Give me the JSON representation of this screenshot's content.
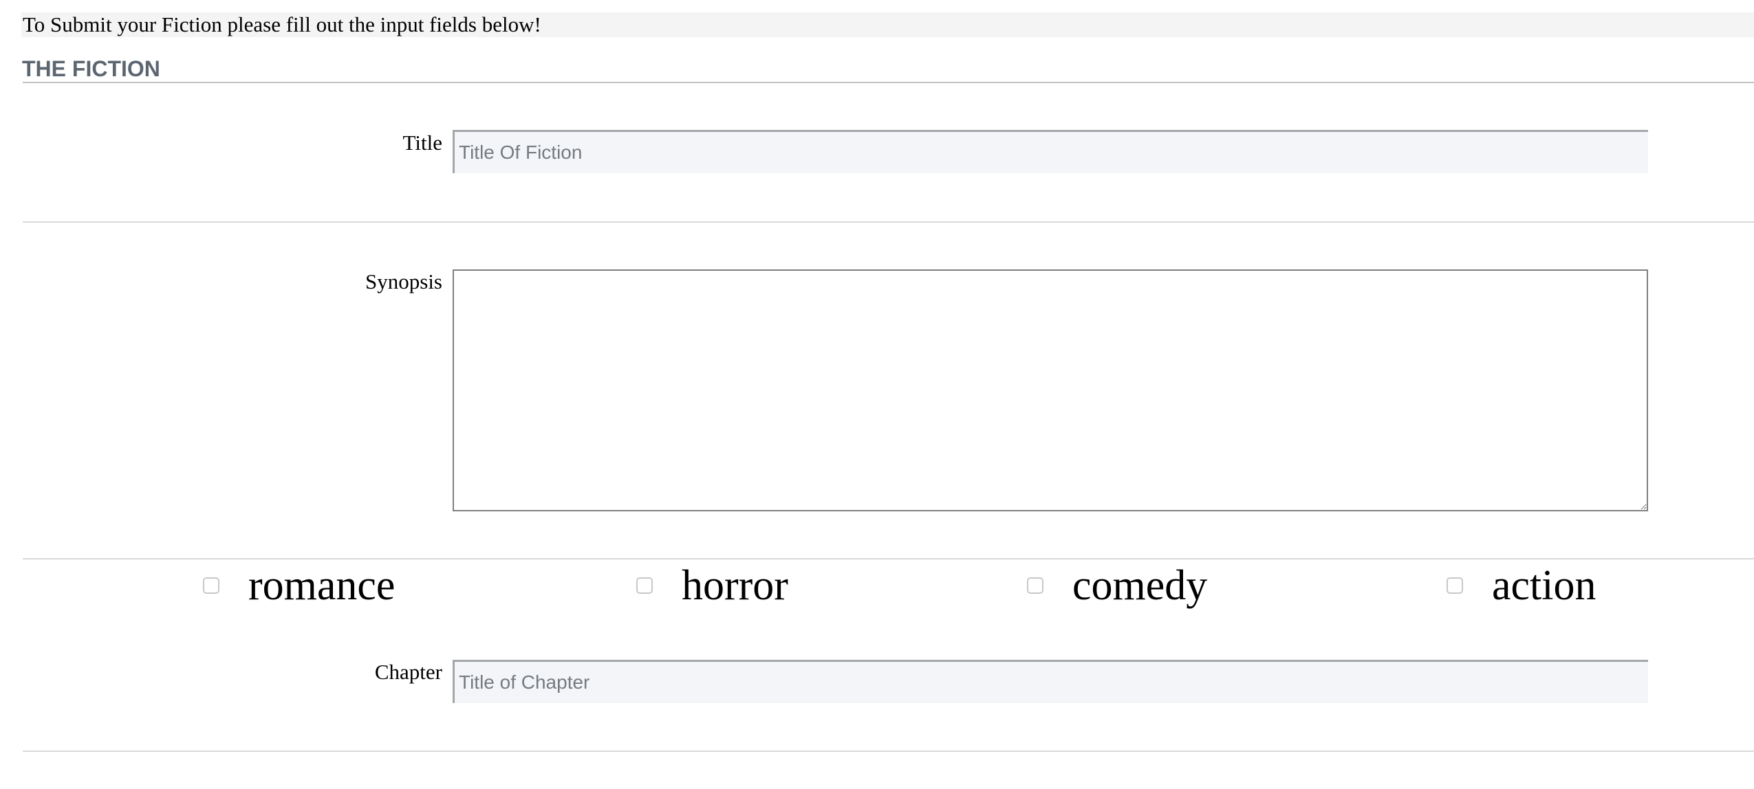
{
  "intro": {
    "text": "To Submit your Fiction please fill out the input fields below!"
  },
  "section": {
    "title": "THE FICTION"
  },
  "title_field": {
    "label": "Title",
    "placeholder": "Title Of Fiction",
    "value": ""
  },
  "synopsis_field": {
    "label": "Synopsis",
    "value": ""
  },
  "genres": [
    {
      "label": "romance",
      "checked": false
    },
    {
      "label": "horror",
      "checked": false
    },
    {
      "label": "comedy",
      "checked": false
    },
    {
      "label": "action",
      "checked": false
    }
  ],
  "chapter_field": {
    "label": "Chapter",
    "placeholder": "Title of Chapter",
    "value": ""
  }
}
